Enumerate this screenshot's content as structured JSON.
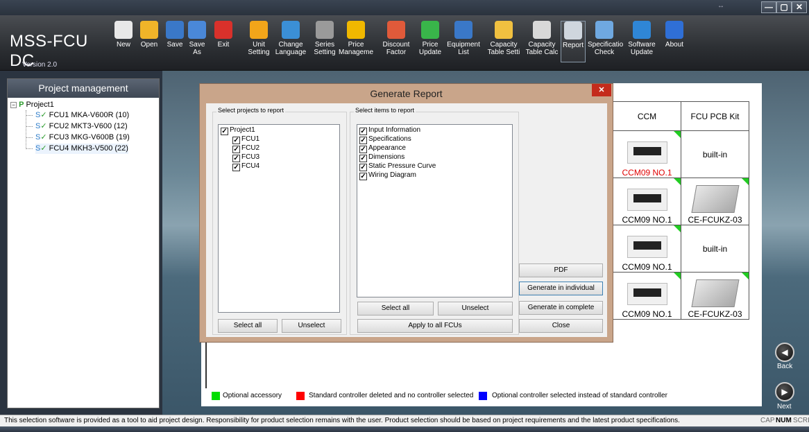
{
  "window": {
    "resize_glyph": "↔",
    "minimize": "—",
    "maximize": "▢",
    "close": "✕"
  },
  "brand": {
    "title": "MSS-FCU DC",
    "version": "Version 2.0"
  },
  "toolbar": [
    {
      "label": "New",
      "icon": "new-document-icon",
      "color": "#e8e8e8"
    },
    {
      "label": "Open",
      "icon": "folder-icon",
      "color": "#f0b429"
    },
    {
      "label": "Save",
      "icon": "save-icon",
      "color": "#3a78c8"
    },
    {
      "label": "Save\nAs",
      "icon": "save-as-icon",
      "color": "#4a88d8"
    },
    {
      "label": "Exit",
      "icon": "exit-icon",
      "color": "#d9312b"
    },
    {
      "label": "Unit\nSetting",
      "icon": "pencil-icon",
      "color": "#f2a51a"
    },
    {
      "label": "Change\nLanguage",
      "icon": "globe-icon",
      "color": "#3b8fd6"
    },
    {
      "label": "Series\nSetting",
      "icon": "tools-icon",
      "color": "#9a9a9a"
    },
    {
      "label": "Price\nManageme",
      "icon": "price-icon",
      "color": "#f0b800"
    },
    {
      "label": "Discount\nFactor",
      "icon": "discount-icon",
      "color": "#e05a3a"
    },
    {
      "label": "Price\nUpdate",
      "icon": "refresh-icon",
      "color": "#39b54a"
    },
    {
      "label": "Equipment\nList",
      "icon": "list-icon",
      "color": "#3a78c8"
    },
    {
      "label": "Capacity\nTable Setti",
      "icon": "gear-icon",
      "color": "#f0c040"
    },
    {
      "label": "Capacity\nTable Calc",
      "icon": "spreadsheet-icon",
      "color": "#d8d8d8"
    },
    {
      "label": "Report",
      "icon": "printer-icon",
      "color": "#cfd6de"
    },
    {
      "label": "Specificatio\nCheck",
      "icon": "magnifier-icon",
      "color": "#6fa8e0"
    },
    {
      "label": "Software\nUpdate",
      "icon": "software-update-icon",
      "color": "#2f86d6"
    },
    {
      "label": "About",
      "icon": "help-icon",
      "color": "#2f6fd6"
    }
  ],
  "project_panel": {
    "title": "Project management",
    "root": "Project1",
    "items": [
      "FCU1 MKA-V600R (10)",
      "FCU2 MKT3-V600 (12)",
      "FCU3 MKG-V600B (19)",
      "FCU4 MKH3-V500 (22)"
    ]
  },
  "ccm_table": {
    "headers": [
      "CCM",
      "FCU PCB Kit"
    ],
    "rows": [
      {
        "ccm": "CCM09 NO.1",
        "ccm_red": true,
        "kit": "built-in",
        "kit_image": false
      },
      {
        "ccm": "CCM09 NO.1",
        "ccm_red": false,
        "kit": "CE-FCUKZ-03",
        "kit_image": true
      },
      {
        "ccm": "CCM09 NO.1",
        "ccm_red": false,
        "kit": "built-in",
        "kit_image": false
      },
      {
        "ccm": "CCM09 NO.1",
        "ccm_red": false,
        "kit": "CE-FCUKZ-03",
        "kit_image": true
      }
    ]
  },
  "legend": [
    {
      "label": "Optional accessory",
      "color": "#00dd00"
    },
    {
      "label": "Standard controller deleted and no controller selected",
      "color": "#ff0000"
    },
    {
      "label": "Optional controller selected instead of standard controller",
      "color": "#0000ff"
    }
  ],
  "nav": {
    "back": "Back",
    "next": "Next"
  },
  "dialog": {
    "title": "Generate Report",
    "close": "✕",
    "projects_group": "Select projects to report",
    "projects": [
      {
        "label": "Project1",
        "checked": true,
        "level": 0
      },
      {
        "label": "FCU1",
        "checked": true,
        "level": 1
      },
      {
        "label": "FCU2",
        "checked": true,
        "level": 1
      },
      {
        "label": "FCU3",
        "checked": true,
        "level": 1
      },
      {
        "label": "FCU4",
        "checked": true,
        "level": 1
      }
    ],
    "projects_select_all": "Select all",
    "projects_unselect": "Unselect",
    "items_group": "Select items to report",
    "items": [
      {
        "label": "Input Information",
        "checked": true
      },
      {
        "label": "Specifications",
        "checked": true
      },
      {
        "label": "Appearance",
        "checked": true
      },
      {
        "label": "Dimensions",
        "checked": true
      },
      {
        "label": "Static Pressure Curve",
        "checked": true
      },
      {
        "label": "Wiring Diagram",
        "checked": true
      }
    ],
    "items_select_all": "Select all",
    "items_unselect": "Unselect",
    "apply_all": "Apply to all FCUs",
    "pdf": "PDF",
    "gen_individual": "Generate in individual",
    "gen_complete": "Generate in complete",
    "close_btn": "Close"
  },
  "statusbar": {
    "message": "This selection software is provided as a tool to aid project design. Responsibility for product selection remains with the user. Product selection should be based on project requirements and the latest product specifications.",
    "cap": "CAP",
    "num": "NUM",
    "scrl": "SCRL"
  }
}
